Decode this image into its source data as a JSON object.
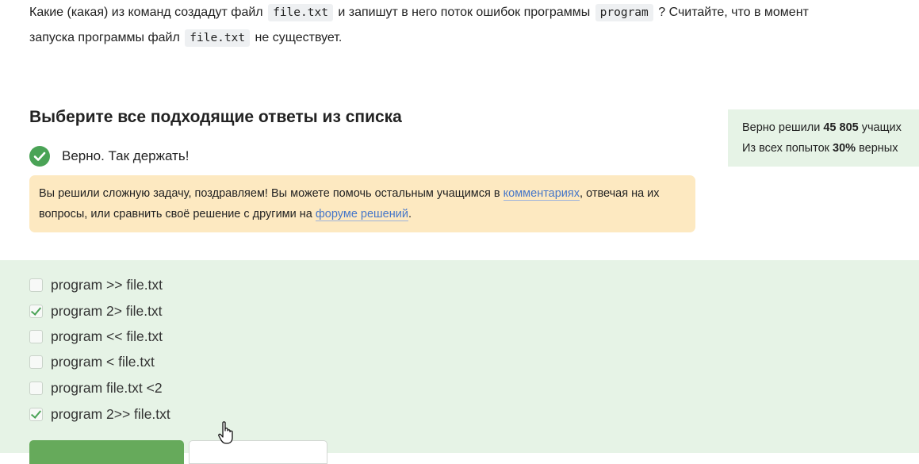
{
  "question": {
    "line1_a": "Какие (какая) из команд создадут файл",
    "code1": "file.txt",
    "line1_b": "и запишут в него поток ошибок программы",
    "code2": "program",
    "line1_c": "? Считайте, что в момент",
    "line2_a": "запуска программы файл",
    "code3": "file.txt",
    "line2_b": "не существует."
  },
  "heading": "Выберите все подходящие ответы из списка",
  "status": {
    "text": "Верно. Так держать!",
    "icon": "check-circle-icon",
    "color": "#4aa356"
  },
  "info": {
    "text_a": "Вы решили сложную задачу, поздравляем! Вы можете помочь остальным учащимся в ",
    "link1": "комментариях",
    "text_b": ", отвечая на их вопросы, или сравнить своё решение с другими на ",
    "link2": "форуме решений",
    "text_c": "."
  },
  "stats": {
    "line1_a": "Верно решили ",
    "line1_num": "45 805",
    "line1_b": " учащих",
    "line2_a": "Из всех попыток ",
    "line2_pct": "30%",
    "line2_b": " верных"
  },
  "options": [
    {
      "label": "program >> file.txt",
      "checked": false
    },
    {
      "label": "program 2> file.txt",
      "checked": true
    },
    {
      "label": "program << file.txt",
      "checked": false
    },
    {
      "label": "program < file.txt",
      "checked": false
    },
    {
      "label": "program file.txt <2",
      "checked": false
    },
    {
      "label": "program 2>> file.txt",
      "checked": true
    }
  ],
  "colors": {
    "success_bg": "#e6f3e6",
    "warning_bg": "#fde9c1",
    "link": "#4676c8",
    "submit": "#66aa5b"
  }
}
